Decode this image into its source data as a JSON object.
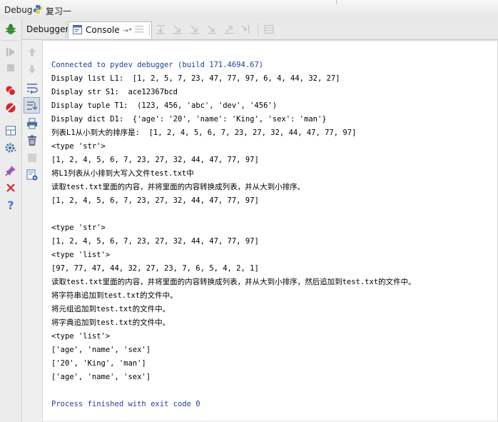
{
  "titlebar": {
    "debug_label": "Debug",
    "config_name": "复习一"
  },
  "tabs": {
    "debugger_label": "Debugger",
    "console_label": "Console",
    "console_pin": "→*"
  },
  "icons": {
    "left": [
      "bug-icon",
      "resume-icon",
      "stop-icon",
      "breakpoints-icon",
      "mute-breakpoints-icon",
      "layout-icon",
      "settings-icon",
      "pin-icon",
      "close-icon",
      "help-icon"
    ],
    "side": [
      "up-arrow-icon",
      "down-arrow-icon",
      "soft-wrap-icon",
      "scroll-to-end-icon",
      "print-icon",
      "trash-icon",
      "blank-icon",
      "console-settings-icon"
    ],
    "toolbar": [
      "show-execution-point-icon",
      "step-over-icon",
      "step-into-icon",
      "step-into-my-code-icon",
      "force-step-into-icon",
      "step-out-icon",
      "run-to-cursor-icon",
      "evaluate-icon"
    ]
  },
  "colors": {
    "system_text": "#1f3fa0",
    "console_bg": "#ffffff",
    "stop_red": "#d9262c",
    "bug_green": "#3e9b3e"
  },
  "console": {
    "lines": [
      {
        "text": "Connected to pydev debugger (build 171.4694.67)",
        "type": "sys"
      },
      {
        "text": "Display list L1:  [1, 2, 5, 7, 23, 47, 77, 97, 6, 4, 44, 32, 27]",
        "type": "out"
      },
      {
        "text": "Display str S1:  ace12367bcd",
        "type": "out"
      },
      {
        "text": "Display tuple T1:  (123, 456, 'abc', 'dev', '456')",
        "type": "out"
      },
      {
        "text": "Display dict D1:  {'age': '20', 'name': 'King', 'sex': 'man'}",
        "type": "out"
      },
      {
        "text": "列表L1从小到大的排序是:  [1, 2, 4, 5, 6, 7, 23, 27, 32, 44, 47, 77, 97]",
        "type": "out"
      },
      {
        "text": "<type 'str'>",
        "type": "out"
      },
      {
        "text": "[1, 2, 4, 5, 6, 7, 23, 27, 32, 44, 47, 77, 97]",
        "type": "out"
      },
      {
        "text": "将L1列表从小排到大写入文件test.txt中",
        "type": "out"
      },
      {
        "text": "读取test.txt里面的内容，并将里面的内容转换成列表，并从大到小排序。",
        "type": "out"
      },
      {
        "text": "[1, 2, 4, 5, 6, 7, 23, 27, 32, 44, 47, 77, 97]",
        "type": "out"
      },
      {
        "text": "",
        "type": "out"
      },
      {
        "text": "<type 'str'>",
        "type": "out"
      },
      {
        "text": "[1, 2, 4, 5, 6, 7, 23, 27, 32, 44, 47, 77, 97]",
        "type": "out"
      },
      {
        "text": "<type 'list'>",
        "type": "out"
      },
      {
        "text": "[97, 77, 47, 44, 32, 27, 23, 7, 6, 5, 4, 2, 1]",
        "type": "out"
      },
      {
        "text": "读取test.txt里面的内容，并将里面的内容转换成列表，并从大到小排序，然后追加到test.txt的文件中。",
        "type": "out"
      },
      {
        "text": "将字符串追加到test.txt的文件中。",
        "type": "out"
      },
      {
        "text": "将元组追加到test.txt的文件中。",
        "type": "out"
      },
      {
        "text": "将字典追加到test.txt的文件中。",
        "type": "out"
      },
      {
        "text": "<type 'list'>",
        "type": "out"
      },
      {
        "text": "['age', 'name', 'sex']",
        "type": "out"
      },
      {
        "text": "['20', 'King', 'man']",
        "type": "out"
      },
      {
        "text": "['age', 'name', 'sex']",
        "type": "out"
      },
      {
        "text": "",
        "type": "out"
      },
      {
        "text": "Process finished with exit code 0",
        "type": "sys"
      }
    ]
  }
}
